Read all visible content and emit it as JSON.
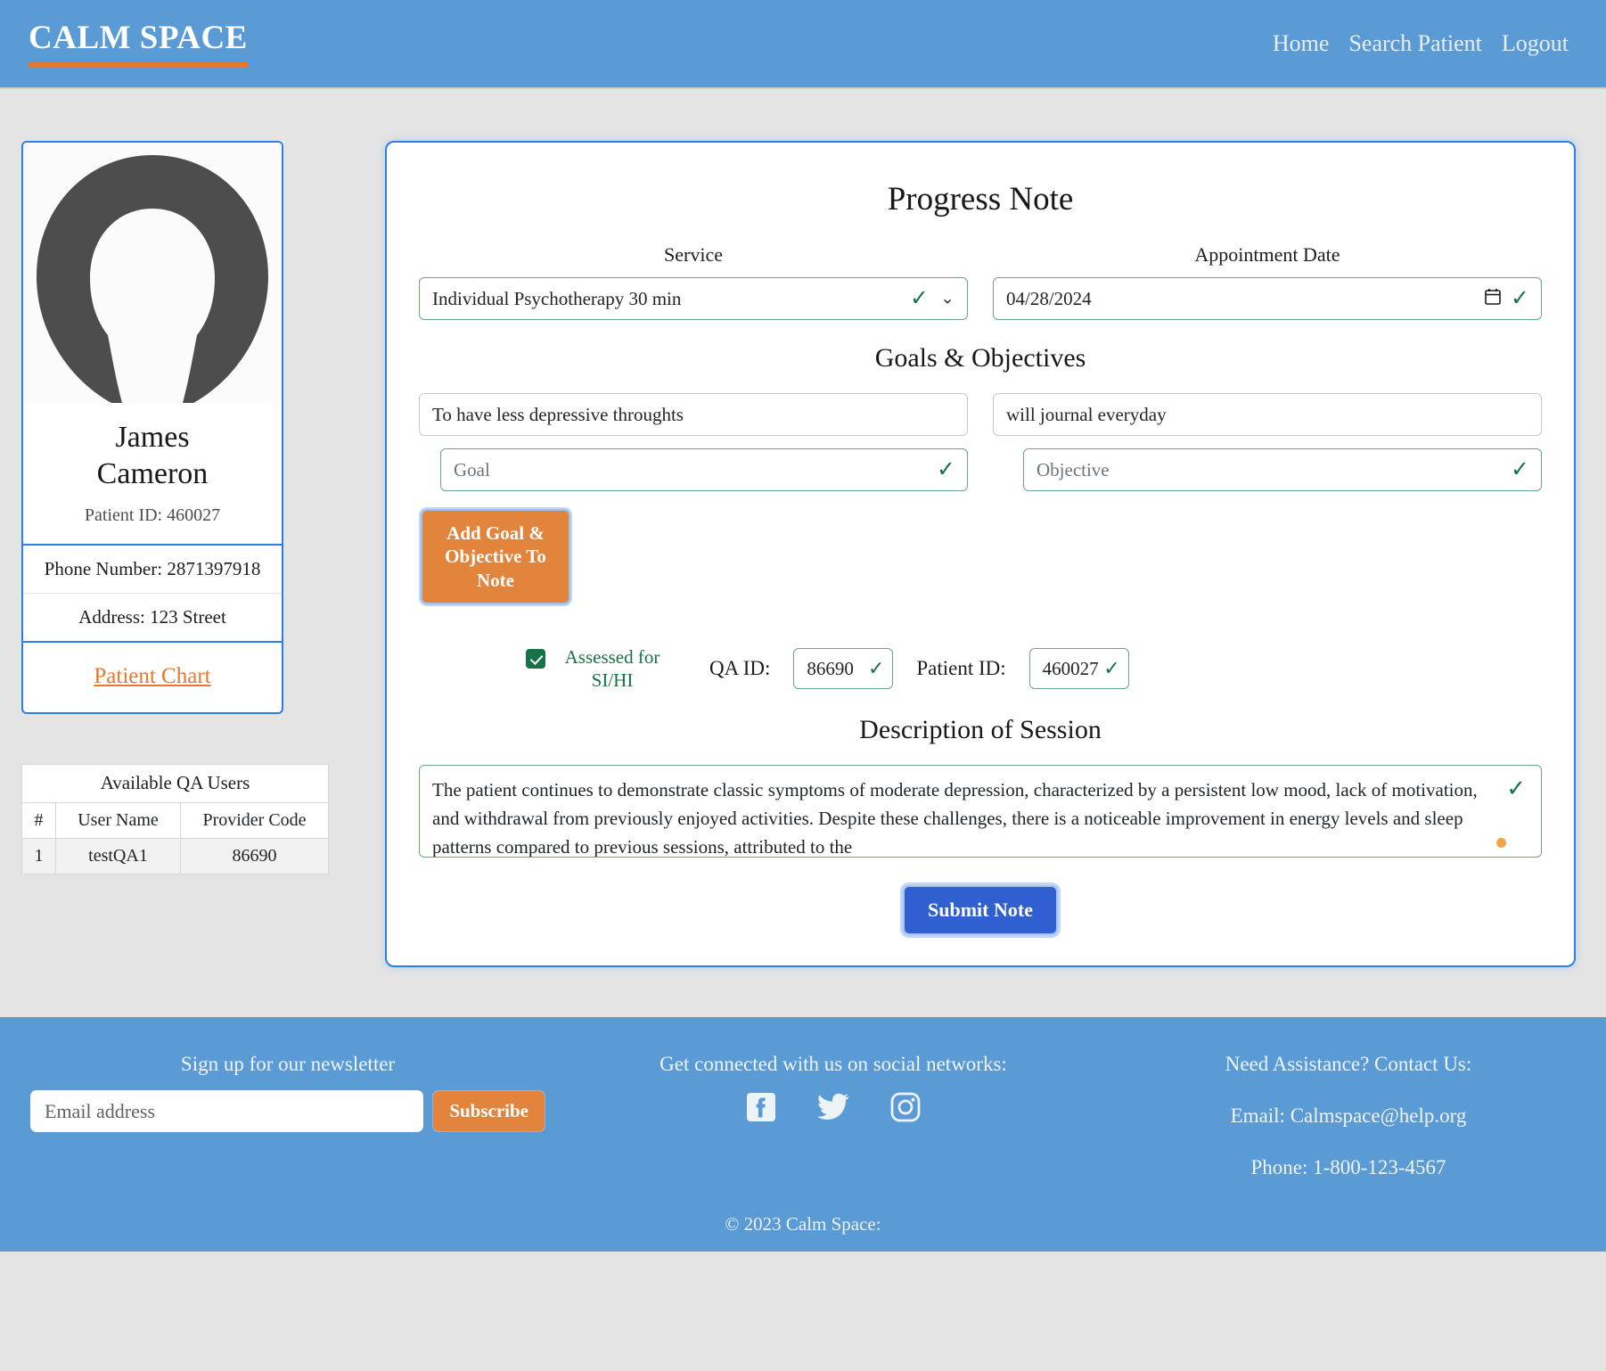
{
  "navbar": {
    "brand": "CALM SPACE",
    "links": [
      {
        "label": "Home"
      },
      {
        "label": "Search Patient"
      },
      {
        "label": "Logout"
      }
    ]
  },
  "patient_card": {
    "avatar_icon": "user-avatar-placeholder",
    "name_line1": "James",
    "name_line2": "Cameron",
    "patient_id_line": "Patient ID: 460027",
    "phone_line": "Phone Number: 2871397918",
    "address_line": "Address: 123 Street",
    "chart_link": "Patient Chart"
  },
  "qa_table": {
    "caption": "Available QA Users",
    "columns": [
      "#",
      "User Name",
      "Provider Code"
    ],
    "rows": [
      {
        "num": "1",
        "user_name": "testQA1",
        "provider_code": "86690"
      }
    ]
  },
  "note": {
    "title": "Progress Note",
    "service_label": "Service",
    "service_value": "Individual Psychotherapy 30 min",
    "appointment_label": "Appointment Date",
    "appointment_value": "04/28/2024",
    "goals_title": "Goals & Objectives",
    "goal_value": "To have less depressive throughts",
    "objective_value": "will journal everyday",
    "goal_placeholder": "Goal",
    "objective_placeholder": "Objective",
    "add_btn_line1": "Add Goal &",
    "add_btn_line2": "Objective To Note",
    "assessed_label_line1": "Assessed for",
    "assessed_label_line2": "SI/HI",
    "qa_id_label": "QA ID:",
    "qa_id_value": "86690",
    "patient_id_label": "Patient ID:",
    "patient_id_value": "460027",
    "description_title": "Description of Session",
    "description_value": "The patient continues to demonstrate classic symptoms of moderate depression, characterized by a persistent low mood, lack of motivation, and withdrawal from previously enjoyed activities. Despite these challenges, there is a noticeable improvement in energy levels and sleep patterns compared to previous sessions, attributed to the",
    "submit_label": "Submit Note"
  },
  "footer": {
    "newsletter_title": "Sign up for our newsletter",
    "email_placeholder": "Email address",
    "email_value": "",
    "subscribe_label": "Subscribe",
    "social_title": "Get connected with us on social networks:",
    "social": [
      {
        "icon": "facebook-icon"
      },
      {
        "icon": "twitter-icon"
      },
      {
        "icon": "instagram-icon"
      }
    ],
    "contact_title": "Need Assistance? Contact Us:",
    "contact_email": "Email: Calmspace@help.org",
    "contact_phone": "Phone: 1-800-123-4567",
    "copyright": "© 2023 Calm Space:"
  },
  "colors": {
    "brand_blue": "#5b9bd5",
    "accent_orange": "#e2843c",
    "valid_green": "#157347",
    "primary_blue": "#2f5fd0",
    "card_border": "#2a7fe8"
  }
}
